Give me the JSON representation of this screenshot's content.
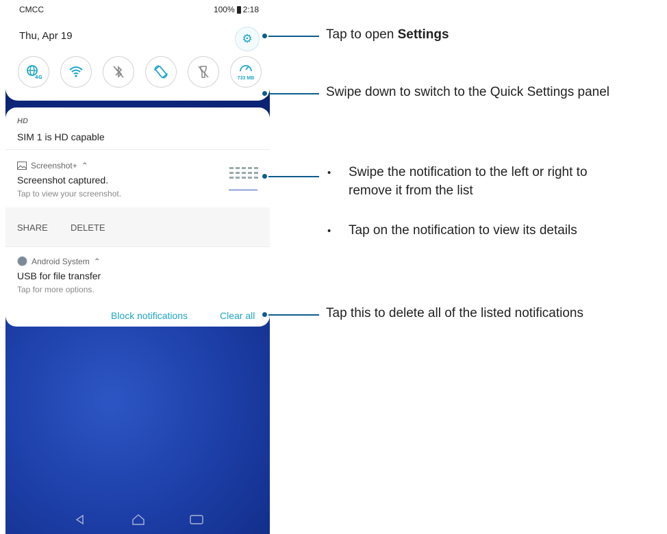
{
  "status_bar": {
    "carrier": "CMCC",
    "battery": "100%",
    "time": "2:18"
  },
  "header": {
    "date": "Thu, Apr 19"
  },
  "quick_tiles": [
    {
      "name": "mobile-data-4g",
      "label": "4G"
    },
    {
      "name": "wifi"
    },
    {
      "name": "bluetooth-off"
    },
    {
      "name": "auto-rotate"
    },
    {
      "name": "flashlight-off"
    },
    {
      "name": "data-usage",
      "label": "733 MB"
    }
  ],
  "notifications": {
    "hd": {
      "app": "HD",
      "title": "SIM 1 is HD capable"
    },
    "screenshot": {
      "app": "Screenshot+",
      "title": "Screenshot captured.",
      "subtitle": "Tap to view your screenshot.",
      "actions": [
        "SHARE",
        "DELETE"
      ]
    },
    "android": {
      "app": "Android System",
      "title": "USB for file transfer",
      "subtitle": "Tap for more options."
    },
    "block_label": "Block notifications",
    "clear_label": "Clear all"
  },
  "annotations": {
    "settings_prefix": "Tap to open ",
    "settings_bold": "Settings",
    "swipe_down": "Swipe down to switch to the Quick Settings panel",
    "swipe_remove": "Swipe the notification to the left or right to remove it from the list",
    "swipe_remove_line1": "Swipe the notification to the left or right to",
    "swipe_remove_line2": "remove it from the list",
    "tap_details": "Tap on the notification to view its details",
    "clear_all": "Tap this to delete all of the listed notifications"
  },
  "colors": {
    "accent": "#1ea6c8",
    "callout": "#0d5c8e",
    "wallpaper": "#1d3fa8"
  }
}
